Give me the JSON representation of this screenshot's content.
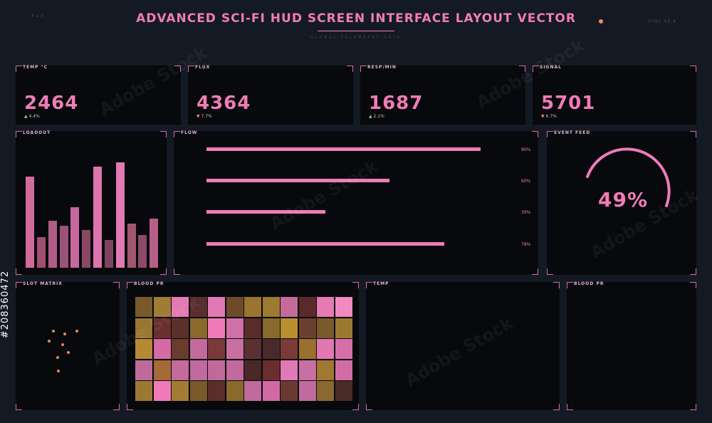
{
  "header": {
    "title": "ADVANCED SCI-FI  HUD SCREEN INTERFACE LAYOUT VECTOR",
    "subtitle": "GLOBAL TELEMETRY GRID",
    "left_code": "A 1 0",
    "right_code": "SYNC 98.4",
    "status_color": "#ff8a50"
  },
  "stats": [
    {
      "label": "TEMP °C",
      "value": "2464",
      "delta": "4.4%",
      "direction": "up"
    },
    {
      "label": "FLUX",
      "value": "4364",
      "delta": "7.7%",
      "direction": "down"
    },
    {
      "label": "RESP/MIN",
      "value": "1687",
      "delta": "2.1%",
      "direction": "up"
    },
    {
      "label": "SIGNAL",
      "value": "5701",
      "delta": "6.7%",
      "direction": "down"
    }
  ],
  "loadout": {
    "label": "LOADOUT",
    "max": 100,
    "bars": [
      {
        "value": 72,
        "color": "#d16a9d"
      },
      {
        "value": 24,
        "color": "#a0506f"
      },
      {
        "value": 37,
        "color": "#b15c86"
      },
      {
        "value": 33,
        "color": "#9c527a"
      },
      {
        "value": 48,
        "color": "#c866a0"
      },
      {
        "value": 30,
        "color": "#8a4866"
      },
      {
        "value": 80,
        "color": "#dd74ae"
      },
      {
        "value": 22,
        "color": "#7f4460"
      },
      {
        "value": 83,
        "color": "#e07ab3"
      },
      {
        "value": 35,
        "color": "#a0566f"
      },
      {
        "value": 26,
        "color": "#8c4a6a"
      },
      {
        "value": 39,
        "color": "#b46089"
      }
    ]
  },
  "flow": {
    "label": "FLOW",
    "items": [
      {
        "percent": "90%",
        "fill": 0.9
      },
      {
        "percent": "60%",
        "fill": 0.6
      },
      {
        "percent": "39%",
        "fill": 0.39
      },
      {
        "percent": "78%",
        "fill": 0.78
      }
    ]
  },
  "event_feed": {
    "label": "EVENT FEED",
    "value": "49%",
    "fraction": 0.49
  },
  "slot_matrix": {
    "label": "SLOT MATRIX"
  },
  "blood_pr_grid": {
    "label": "BLOOD PR",
    "rows": [
      [
        "#7a5a2a",
        "#a07c35",
        "#e47ab3",
        "#5a2e2e",
        "#e07ab5",
        "#6f4a2a",
        "#9a7430",
        "#9c7a32",
        "#c66a9c",
        "#5a2a2a",
        "#e57ab6",
        "#f08ac0"
      ],
      [
        "#9a7630",
        "#6a3030",
        "#5a3028",
        "#8a6a2a",
        "#f07ab8",
        "#d070a8",
        "#5a2c2c",
        "#8a6a2c",
        "#b89030",
        "#6a4030",
        "#7a5a2a",
        "#9a7a32"
      ],
      [
        "#b48a35",
        "#d66aa5",
        "#6a3c2c",
        "#c66a9e",
        "#7a3a3a",
        "#c870a2",
        "#5a3030",
        "#4a2a28",
        "#7a3a38",
        "#9a7030",
        "#e277b2",
        "#d66fa8"
      ],
      [
        "#c06a9c",
        "#a46a38",
        "#c46a9c",
        "#c06aa0",
        "#c06a9c",
        "#c26aa0",
        "#4a2828",
        "#6a2e2e",
        "#e07ab6",
        "#c870a4",
        "#a07830",
        "#d06ea4"
      ],
      [
        "#9a7a32",
        "#f07ab8",
        "#a27c34",
        "#7a5a2a",
        "#5a2e2a",
        "#8a6a2a",
        "#c06a9e",
        "#d06aa4",
        "#6a3a30",
        "#c06a9e",
        "#8a6830",
        "#4a2a26"
      ]
    ]
  },
  "temp_panel": {
    "label": "TEMP"
  },
  "blood_pr_panel": {
    "label": "BLOOD PR"
  },
  "watermark": "Adobe Stock",
  "side_id": "#208360472",
  "colors": {
    "accent": "#f07cb6",
    "up": "#6fd48a",
    "down": "#ff8a50",
    "panel": "#08090c",
    "bg": "#131a24"
  }
}
